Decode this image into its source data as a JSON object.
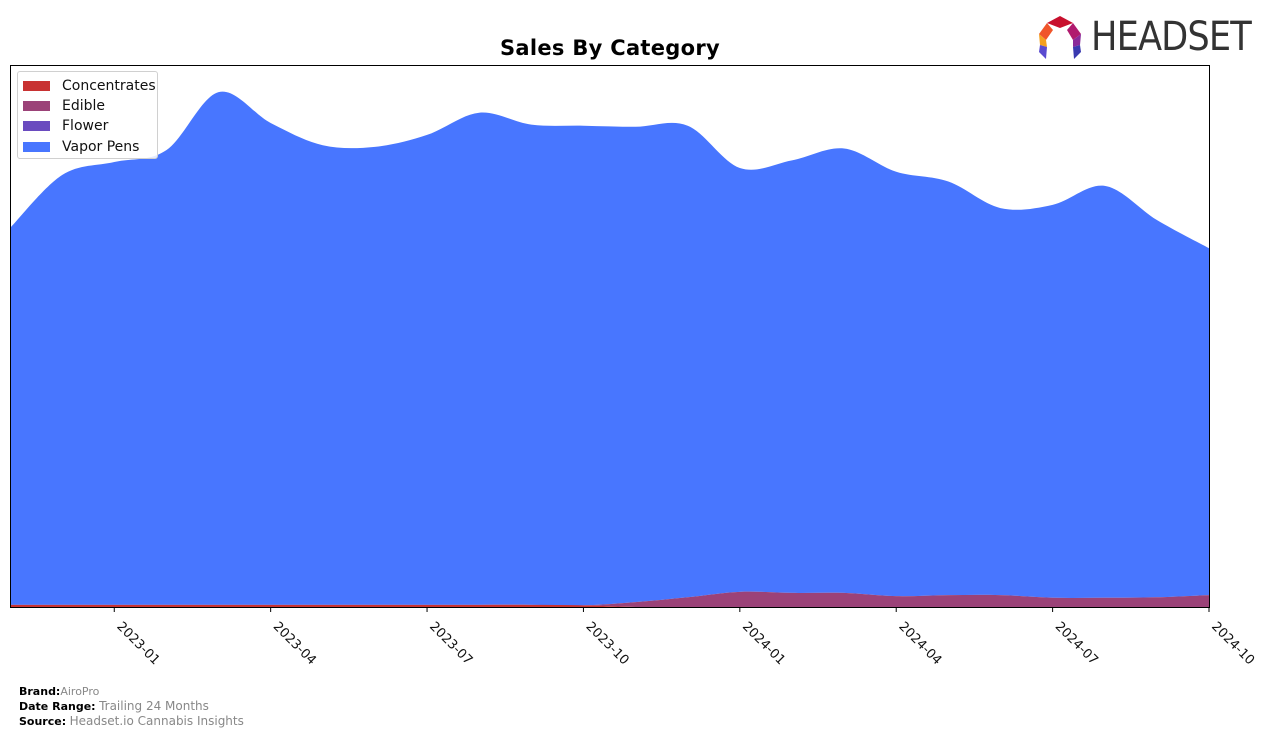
{
  "chart_data": {
    "type": "area",
    "stacked": true,
    "title": "Sales By Category",
    "xlabel": "",
    "ylabel": "",
    "x": [
      "2022-11",
      "2022-12",
      "2023-01",
      "2023-02",
      "2023-03",
      "2023-04",
      "2023-05",
      "2023-06",
      "2023-07",
      "2023-08",
      "2023-09",
      "2023-10",
      "2023-11",
      "2023-12",
      "2024-01",
      "2024-02",
      "2024-03",
      "2024-04",
      "2024-05",
      "2024-06",
      "2024-07",
      "2024-08",
      "2024-09",
      "2024-10"
    ],
    "x_ticks": [
      "2023-01",
      "2023-04",
      "2023-07",
      "2023-10",
      "2024-01",
      "2024-04",
      "2024-07",
      "2024-10"
    ],
    "ylim": [
      0,
      100
    ],
    "y_ticks_visible": false,
    "grid": false,
    "legend_position": "top-left",
    "series": [
      {
        "name": "Concentrates",
        "color": "#c83232",
        "values": [
          0.4,
          0.4,
          0.4,
          0.4,
          0.4,
          0.4,
          0.4,
          0.4,
          0.4,
          0.4,
          0.4,
          0.3,
          0,
          0,
          0,
          0,
          0,
          0,
          0,
          0,
          0,
          0,
          0,
          0
        ]
      },
      {
        "name": "Edible",
        "color": "#9b4278",
        "values": [
          0,
          0,
          0,
          0,
          0,
          0,
          0,
          0,
          0,
          0,
          0,
          0,
          0.9,
          1.8,
          2.8,
          2.6,
          2.6,
          2.0,
          2.2,
          2.2,
          1.7,
          1.7,
          1.8,
          2.2
        ]
      },
      {
        "name": "Flower",
        "color": "#6a4bbf",
        "values": [
          0,
          0,
          0,
          0,
          0,
          0,
          0,
          0,
          0,
          0,
          0,
          0,
          0,
          0,
          0,
          0,
          0,
          0,
          0,
          0,
          0,
          0,
          0,
          0
        ]
      },
      {
        "name": "Vapor Pens",
        "color": "#4876ff",
        "values": [
          69.5,
          79.3,
          81.7,
          83.9,
          94.6,
          88.9,
          84.8,
          84.5,
          86.7,
          90.8,
          88.6,
          88.5,
          87.7,
          87.0,
          78.2,
          79.8,
          82.0,
          78.3,
          76.3,
          71.4,
          72.5,
          76.0,
          69.6,
          64.0
        ]
      }
    ]
  },
  "legend": {
    "items": [
      {
        "label": "Concentrates",
        "color": "#c83232"
      },
      {
        "label": "Edible",
        "color": "#9b4278"
      },
      {
        "label": "Flower",
        "color": "#6a4bbf"
      },
      {
        "label": "Vapor Pens",
        "color": "#4876ff"
      }
    ]
  },
  "logo": {
    "text": "HEADSET"
  },
  "footer": {
    "brand_key": "Brand:",
    "brand_val": "AiroPro",
    "range_key": "Date Range:",
    "range_val": "Trailing 24 Months",
    "source_key": "Source:",
    "source_val": "Headset.io Cannabis Insights"
  }
}
